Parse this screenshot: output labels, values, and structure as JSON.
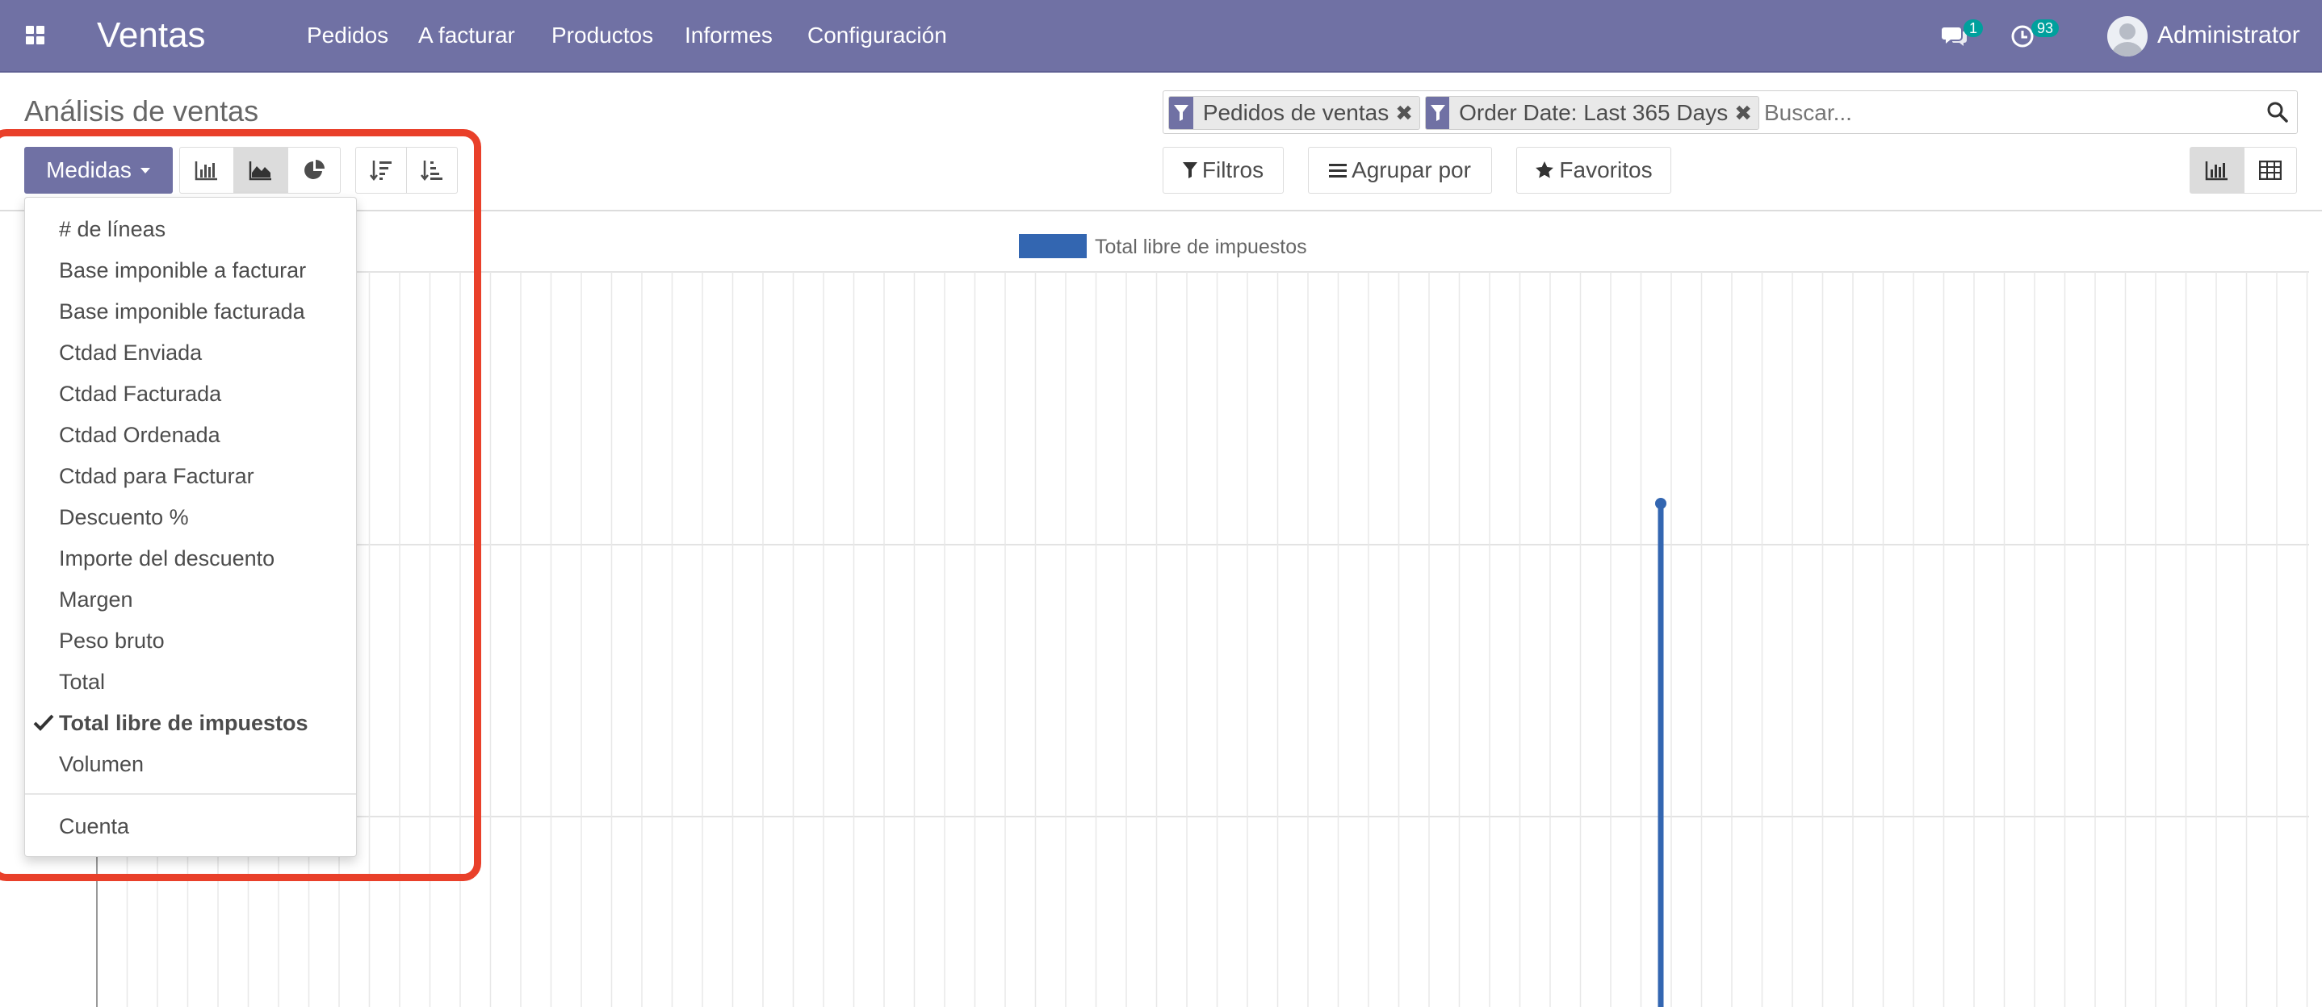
{
  "navbar": {
    "brand": "Ventas",
    "menu": [
      "Pedidos",
      "A facturar",
      "Productos",
      "Informes",
      "Configuración"
    ],
    "messages_count": "1",
    "activities_count": "93",
    "user_name": "Administrator"
  },
  "control_panel": {
    "title": "Análisis de ventas",
    "facets": [
      {
        "label": "Pedidos de ventas"
      },
      {
        "label": "Order Date: Last 365 Days"
      }
    ],
    "search_placeholder": "Buscar...",
    "measures_button": "Medidas",
    "filters_button": "Filtros",
    "group_by_button": "Agrupar por",
    "favorites_button": "Favoritos"
  },
  "measures_dropdown": {
    "items": [
      "# de líneas",
      "Base imponible a facturar",
      "Base imponible facturada",
      "Ctdad Enviada",
      "Ctdad Facturada",
      "Ctdad Ordenada",
      "Ctdad para Facturar",
      "Descuento %",
      "Importe del descuento",
      "Margen",
      "Peso bruto",
      "Total",
      "Total libre de impuestos",
      "Volumen"
    ],
    "selected": "Total libre de impuestos",
    "extra_item": "Cuenta"
  },
  "chart_data": {
    "type": "line",
    "series": [
      {
        "name": "Total libre de impuestos",
        "color": "#3366b1"
      }
    ]
  },
  "colors": {
    "navbar": "#7071a4",
    "badge": "#00a09d",
    "series": "#3366b1",
    "highlight": "#e9402a"
  }
}
